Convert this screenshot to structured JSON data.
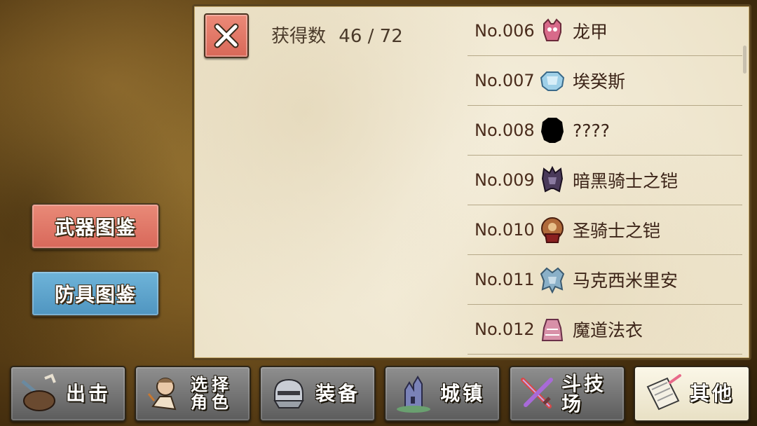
{
  "side_menu": {
    "weapon_label": "武器图鉴",
    "armor_label": "防具图鉴",
    "weapon_color": "#e07868",
    "armor_color": "#5aa4cc"
  },
  "panel": {
    "close_icon": "close-icon",
    "count_label": "获得数",
    "count_value": "46 / 72",
    "items": [
      {
        "number": "No.006",
        "name": "龙甲",
        "icon": "dragon-armor-icon"
      },
      {
        "number": "No.007",
        "name": "埃癸斯",
        "icon": "aegis-armor-icon"
      },
      {
        "number": "No.008",
        "name": "????",
        "icon": "unknown-silhouette-icon"
      },
      {
        "number": "No.009",
        "name": "暗黑骑士之铠",
        "icon": "dark-knight-armor-icon"
      },
      {
        "number": "No.010",
        "name": "圣骑士之铠",
        "icon": "paladin-armor-icon"
      },
      {
        "number": "No.011",
        "name": "马克西米里安",
        "icon": "maximilian-armor-icon"
      },
      {
        "number": "No.012",
        "name": "魔道法衣",
        "icon": "magic-robe-icon"
      }
    ]
  },
  "tabs": [
    {
      "label": "出击",
      "icon": "sortie-pot-icon",
      "active": false
    },
    {
      "label": "选择角色",
      "line1": "选择",
      "line2": "角色",
      "icon": "character-select-icon",
      "active": false
    },
    {
      "label": "装备",
      "icon": "equipment-helmet-icon",
      "active": false
    },
    {
      "label": "城镇",
      "icon": "town-castle-icon",
      "active": false
    },
    {
      "label": "斗技场",
      "icon": "arena-swords-icon",
      "active": false
    },
    {
      "label": "其他",
      "icon": "other-scroll-icon",
      "active": true
    }
  ]
}
